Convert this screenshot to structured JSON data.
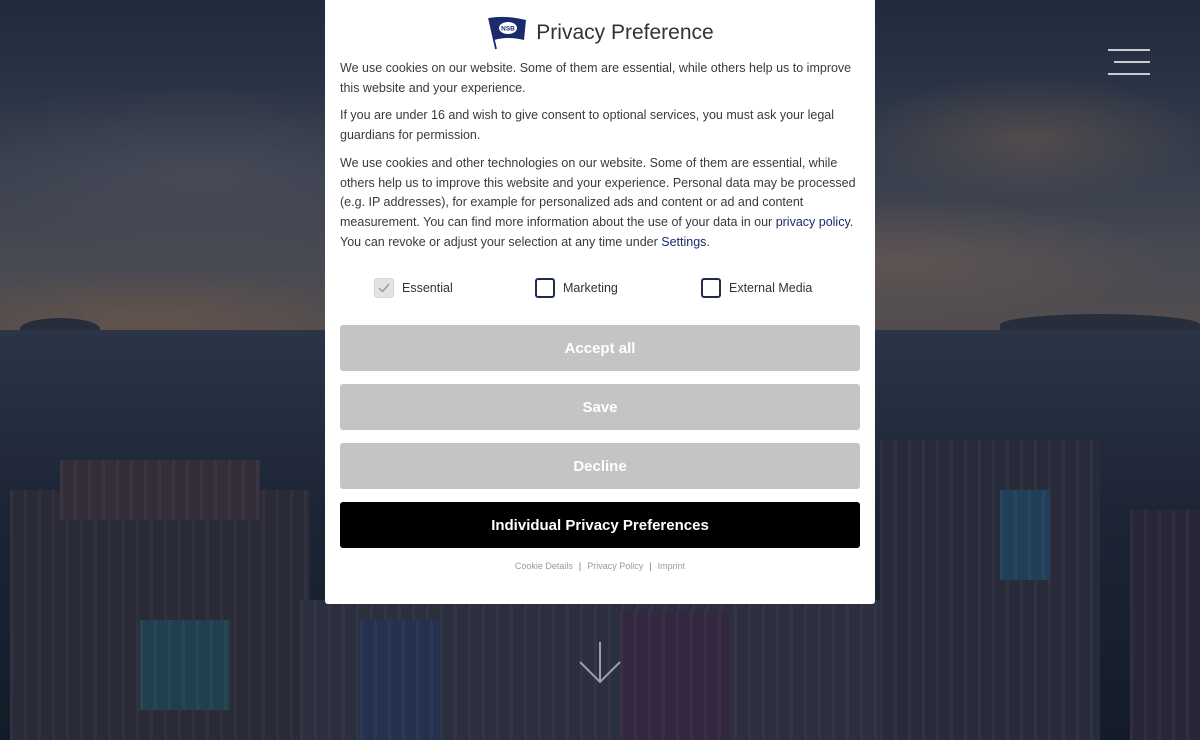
{
  "modal": {
    "title": "Privacy Preference",
    "logo_text": "NSB",
    "paragraph1": "We use cookies on our website. Some of them are essential, while others help us to improve this website and your experience.",
    "paragraph2": "If you are under 16 and wish to give consent to optional services, you must ask your legal guardians for permission.",
    "paragraph3_part1": "We use cookies and other technologies on our website. Some of them are essential, while others help us to improve this website and your experience. Personal data may be processed (e.g. IP addresses), for example for personalized ads and content or ad and content measurement. You can find more information about the use of your data in our ",
    "privacy_policy_link": "privacy policy",
    "paragraph3_part2": ". You can revoke or adjust your selection at any time under ",
    "settings_link": "Settings",
    "paragraph3_end": ".",
    "checkboxes": [
      {
        "label": "Essential",
        "checked": true,
        "disabled": true
      },
      {
        "label": "Marketing",
        "checked": false,
        "disabled": false
      },
      {
        "label": "External Media",
        "checked": false,
        "disabled": false
      }
    ],
    "buttons": {
      "accept_all": "Accept all",
      "save": "Save",
      "decline": "Decline",
      "individual": "Individual Privacy Preferences"
    },
    "footer_links": {
      "cookie_details": "Cookie Details",
      "privacy_policy": "Privacy Policy",
      "imprint": "Imprint",
      "separator": "|"
    }
  },
  "colors": {
    "accent": "#1b2a6b",
    "button_grey": "#c4c4c4",
    "button_black": "#000000",
    "checkbox_border": "#1f2a4d"
  },
  "icons": {
    "menu": "hamburger-menu-icon",
    "scroll": "arrow-down-icon",
    "check": "checkmark-icon"
  }
}
